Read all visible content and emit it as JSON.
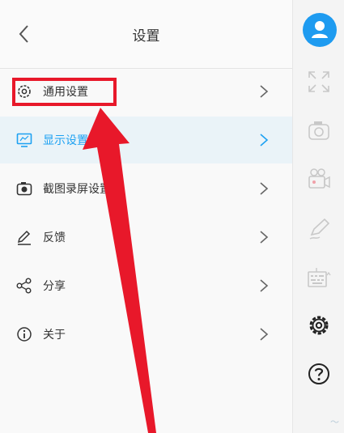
{
  "header": {
    "title": "设置"
  },
  "menu": [
    {
      "label": "通用设置"
    },
    {
      "label": "显示设置"
    },
    {
      "label": "截图录屏设置"
    },
    {
      "label": "反馈"
    },
    {
      "label": "分享"
    },
    {
      "label": "关于"
    }
  ],
  "sidebar": {
    "icons": [
      "user-icon",
      "expand-icon",
      "camera-icon",
      "video-camera-icon",
      "pen-icon",
      "keyboard-icon",
      "gear-icon",
      "help-icon"
    ]
  },
  "colors": {
    "accent": "#1da1f2",
    "highlight": "#e8182a"
  }
}
